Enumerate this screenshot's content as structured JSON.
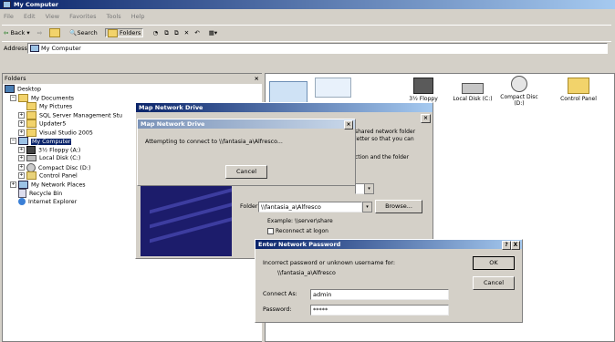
{
  "window": {
    "title": "My Computer"
  },
  "menu": [
    "File",
    "Edit",
    "View",
    "Favorites",
    "Tools",
    "Help"
  ],
  "toolbar": {
    "back": "Back",
    "search": "Search",
    "folders": "Folders"
  },
  "address": {
    "label": "Address",
    "value": "My Computer"
  },
  "folders_panel": {
    "title": "Folders",
    "items": [
      {
        "label": "Desktop"
      },
      {
        "label": "My Documents"
      },
      {
        "label": "My Pictures"
      },
      {
        "label": "SQL Server Management Stu"
      },
      {
        "label": "Updater5"
      },
      {
        "label": "Visual Studio 2005"
      },
      {
        "label": "My Computer"
      },
      {
        "label": "3½ Floppy (A:)"
      },
      {
        "label": "Local Disk (C:)"
      },
      {
        "label": "Compact Disc (D:)"
      },
      {
        "label": "Control Panel"
      },
      {
        "label": "My Network Places"
      },
      {
        "label": "Recycle Bin"
      },
      {
        "label": "Internet Explorer"
      }
    ]
  },
  "drives": [
    {
      "label": "3½ Floppy"
    },
    {
      "label": "Local Disk (C:)"
    },
    {
      "label": "Compact Disc (D:)"
    },
    {
      "label": "Control Panel"
    }
  ],
  "map_drive_outer": {
    "title": "Map Network Drive"
  },
  "map_drive_inner": {
    "title": "Map Network Drive",
    "message": "Attempting to connect to \\\\fantasia_a\\Alfresco...",
    "cancel": "Cancel"
  },
  "map_form": {
    "desc1": "shared network folder",
    "desc2": "letter so that you can",
    "desc3": "ction and the folder",
    "folder_label": "Folder:",
    "folder_value": "\\\\fantasia_a\\Alfresco",
    "browse": "Browse...",
    "example": "Example: \\\\server\\share",
    "reconnect": "Reconnect at logon"
  },
  "password_dialog": {
    "title": "Enter Network Password",
    "help": "?",
    "close": "X",
    "message1": "Incorrect password or unknown username for:",
    "message2": "\\\\fantasia_a\\Alfresco",
    "connect_as_label": "Connect As:",
    "connect_as_value": "admin",
    "password_label": "Password:",
    "password_value": "*****",
    "ok": "OK",
    "cancel": "Cancel"
  }
}
